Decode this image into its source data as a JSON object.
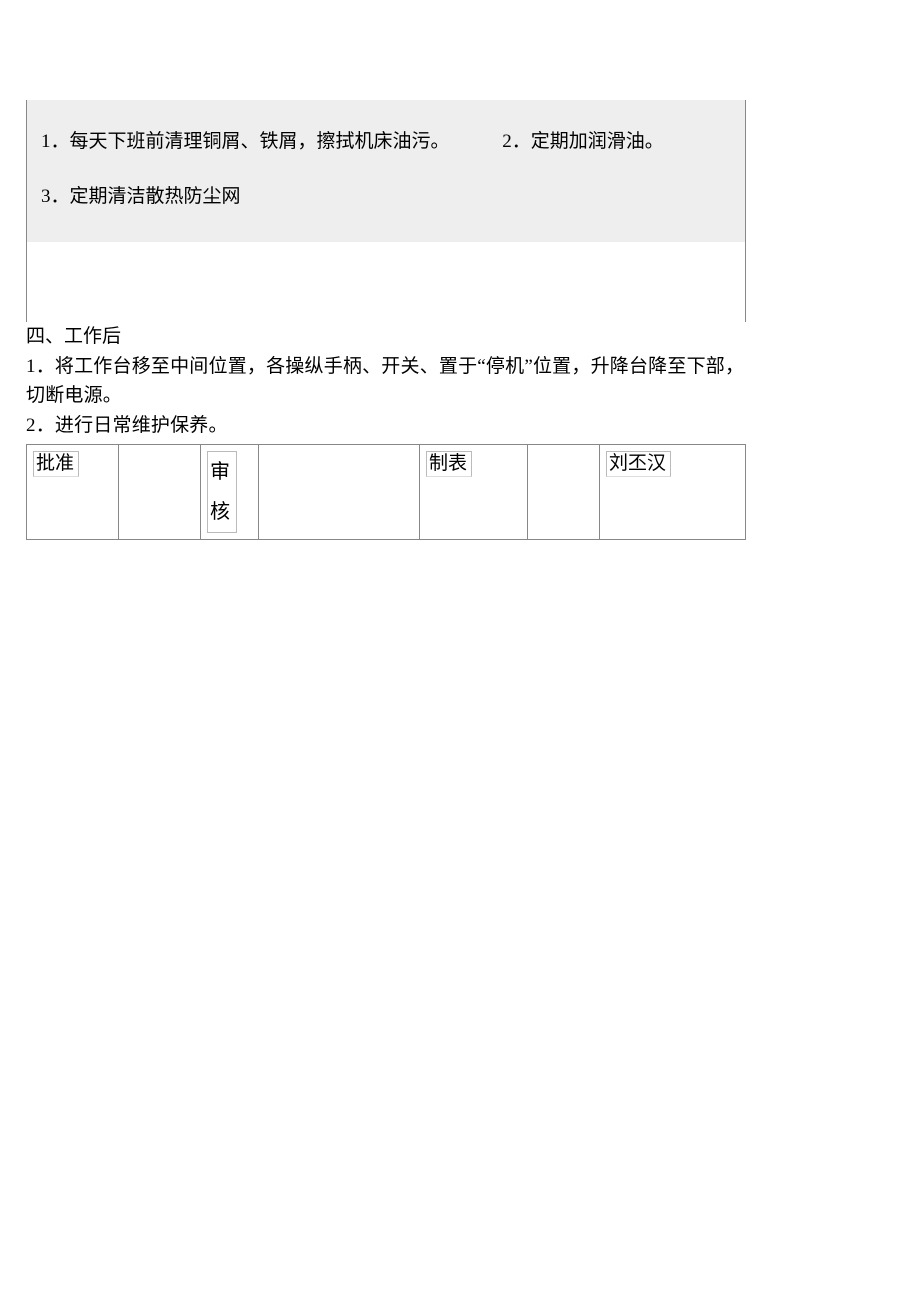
{
  "maintenance": {
    "items": [
      "1．每天下班前清理铜屑、铁屑，擦拭机床油污。",
      "2．定期加润滑油。",
      "3．定期清洁散热防尘网"
    ]
  },
  "section4": {
    "heading": "四、工作后",
    "items": [
      "1．将工作台移至中间位置，各操纵手柄、开关、置于“停机”位置，升降台降至下部，切断电源。",
      "2．进行日常维护保养。"
    ]
  },
  "signoff": {
    "approve_label": "批准",
    "approve_value": "",
    "review_label": "审核",
    "review_value": "",
    "prepare_label": "制表",
    "prepare_value": "刘丕汉"
  }
}
